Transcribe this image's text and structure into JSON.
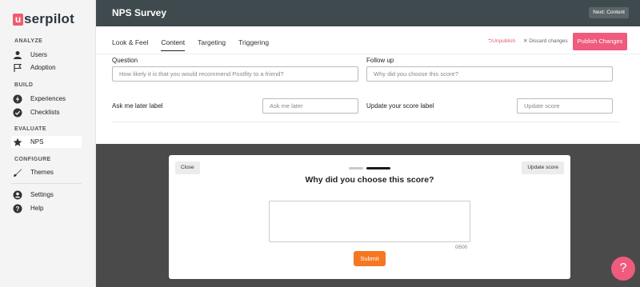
{
  "app": {
    "logo_mark": "u",
    "logo_text": "serpilot"
  },
  "sidebar": {
    "sections": {
      "analyze": "ANALYZE",
      "build": "BUILD",
      "evaluate": "EVALUATE",
      "configure": "CONFIGURE"
    },
    "items": {
      "users": "Users",
      "adoption": "Adoption",
      "experiences": "Experiences",
      "checklists": "Checklists",
      "nps": "NPS",
      "themes": "Themes",
      "settings": "Settings",
      "help": "Help"
    }
  },
  "header": {
    "title": "NPS Survey",
    "next_label": "Next: Content"
  },
  "tabs": [
    "Look & Feel",
    "Content",
    "Targeting",
    "Triggering"
  ],
  "actions": {
    "unpublish": "⮌Unpublish",
    "discard": "✕ Discard changes",
    "publish": "Publish Changes"
  },
  "form": {
    "question_label": "Question",
    "question_placeholder": "How likely it is that you would recommend Postfity to a friend?",
    "followup_label": "Follow up",
    "followup_placeholder": "Why did you choose this score?",
    "ask_later_label": "Ask me later label",
    "ask_later_placeholder": "Ask me later",
    "update_score_label": "Update your score label",
    "update_score_placeholder": "Update score"
  },
  "preview": {
    "close_label": "Close",
    "update_label": "Update score",
    "question": "Why did you choose this score?",
    "char_count": "0/500",
    "submit_label": "Submit"
  },
  "help_fab": "?"
}
